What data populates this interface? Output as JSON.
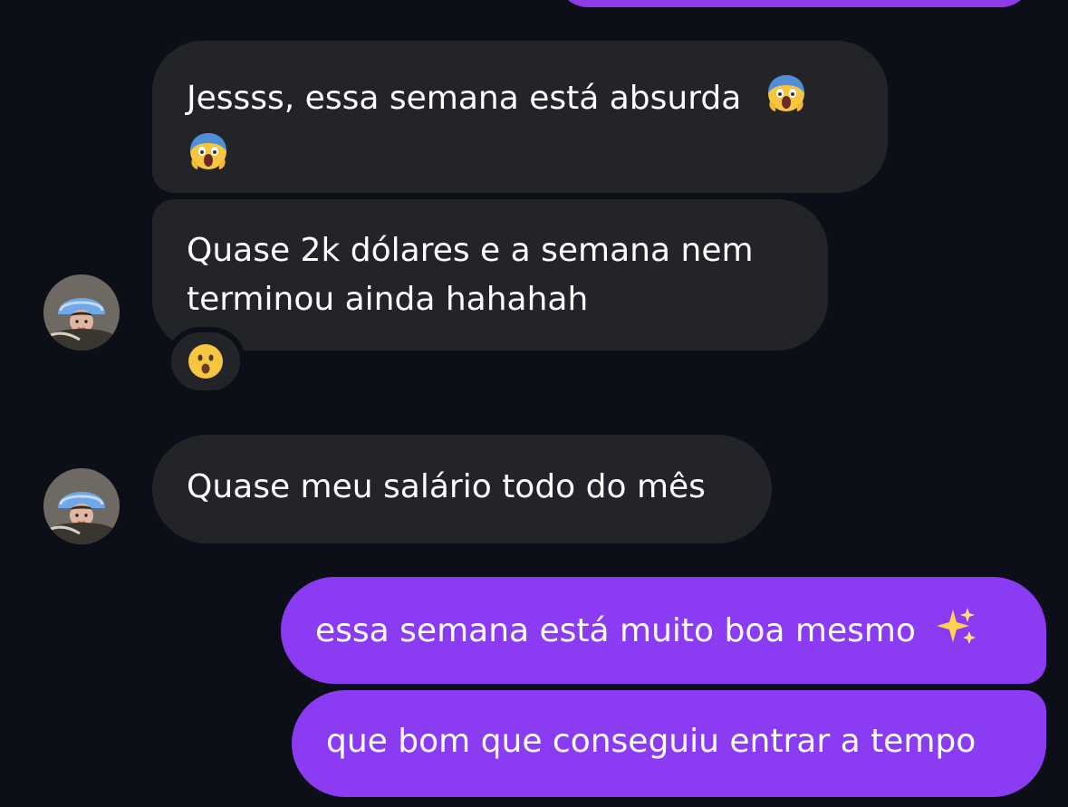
{
  "messages": [
    {
      "text_line1": "Jessss, essa semana está absurda",
      "emoji": "scream-emoji"
    },
    {
      "line1": "Quase 2k dólares e a semana nem",
      "line2": "terminou ainda hahahah",
      "reaction": "astonished-face-emoji"
    },
    {
      "text": "Quase meu salário todo do mês"
    },
    {
      "text": "essa semana está muito boa mesmo",
      "emoji": "sparkles-emoji"
    },
    {
      "text": "que bom que conseguiu entrar a tempo"
    }
  ],
  "colors": {
    "background": "#0c0f17",
    "incoming_bubble": "#232428",
    "outgoing_bubble": "#8b3cf3",
    "text": "#ffffff"
  }
}
